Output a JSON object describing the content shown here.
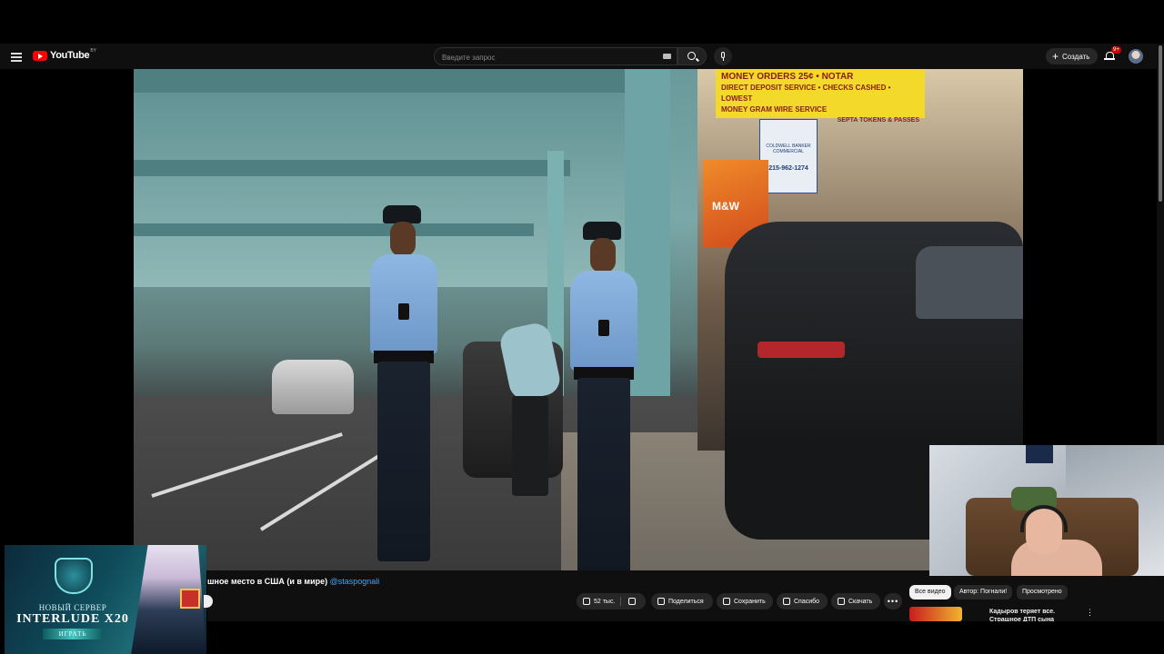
{
  "header": {
    "logo_text": "YouTube",
    "logo_region": "BY",
    "search_placeholder": "Введите запрос",
    "create_label": "Создать",
    "notification_count": "9+"
  },
  "video": {
    "title": "шное место в США (и в мире)",
    "channel_handle": "@staspognali",
    "scene_text": {
      "sign_yellow_line1": "MONEY ORDERS 25¢ • NOTAR",
      "sign_yellow_line2": "DIRECT DEPOSIT SERVICE • CHECKS CASHED • LOWEST",
      "sign_yellow_line3": "MONEY GRAM WIRE SERVICE",
      "sign_yellow_line4": "SEPTA TOKENS & PASSES",
      "sign_cb_line1": "COLDWELL BANKER",
      "sign_cb_line2": "COMMERCIAL",
      "sign_cb_phone": "215-962-1274",
      "awning_text": "M&W"
    }
  },
  "actions": {
    "like_count": "52 тыс.",
    "share_label": "Поделиться",
    "save_label": "Сохранить",
    "thanks_label": "Спасибо",
    "download_label": "Скачать",
    "more_label": "•••"
  },
  "sidebar": {
    "chips": [
      "Все видео",
      "Автор: Погнали!",
      "Просмотрено"
    ],
    "recommended": {
      "title": "Кадыров теряет все. Страшное ДТП сына"
    }
  },
  "ad": {
    "line1": "НОВЫЙ СЕРВЕР",
    "line2": "INTERLUDE X20",
    "cta": "ИГРАТЬ"
  },
  "colors": {
    "accent_red": "#ff0000",
    "link_blue": "#3ea6ff",
    "bg_dark": "#0f0f0f"
  }
}
